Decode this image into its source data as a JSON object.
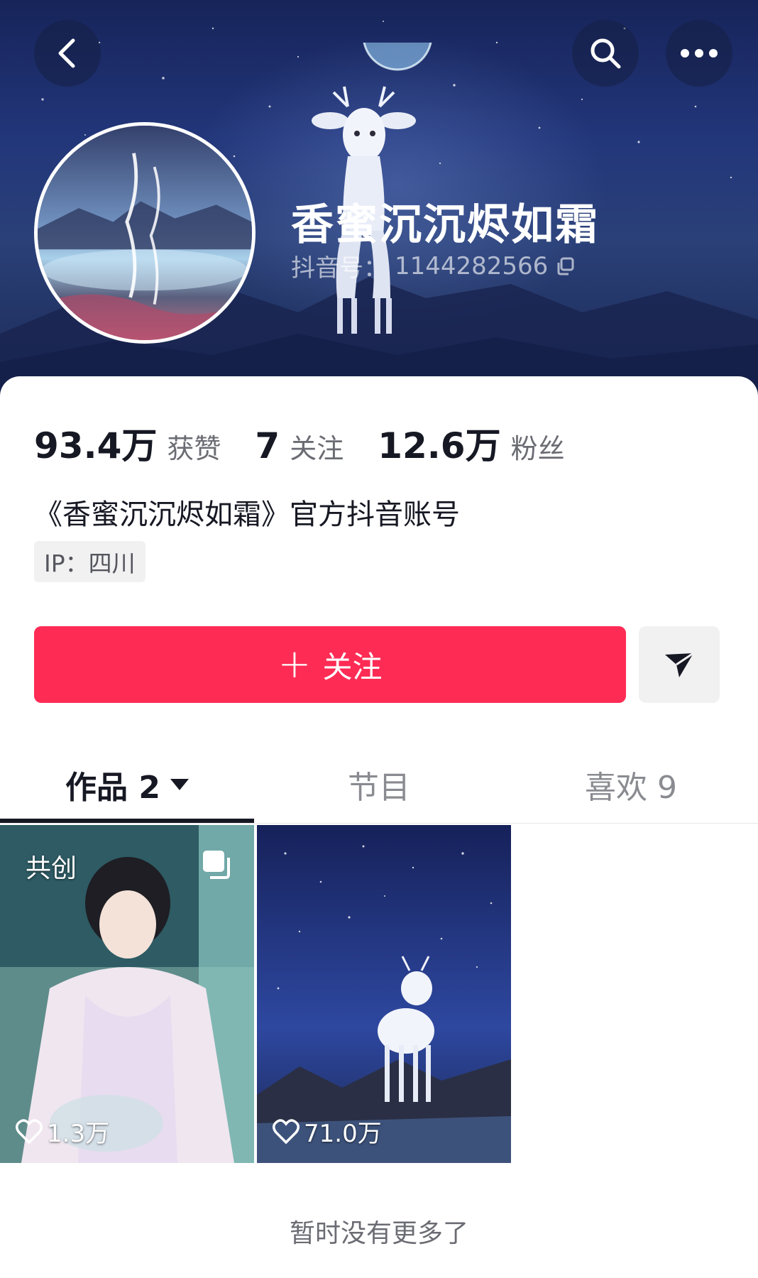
{
  "header": {
    "back_icon": "chevron-left-icon",
    "search_icon": "search-icon",
    "more_icon": "more-horizontal-icon"
  },
  "profile": {
    "name": "香蜜沉沉烬如霜",
    "douyin_id_label": "抖音号：",
    "douyin_id": "1144282566",
    "copy_icon": "copy-icon"
  },
  "stats": [
    {
      "value": "93.4万",
      "label": "获赞"
    },
    {
      "value": "7",
      "label": "关注"
    },
    {
      "value": "12.6万",
      "label": "粉丝"
    }
  ],
  "bio": "《香蜜沉沉烬如霜》官方抖音账号",
  "ip_tag": "IP：四川",
  "actions": {
    "follow_plus": "+",
    "follow_label": "关注",
    "follow_color": "#fe2c55",
    "share_icon": "send-icon"
  },
  "tabs": [
    {
      "label": "作品 2",
      "active": true
    },
    {
      "label": "节目",
      "active": false
    },
    {
      "label": "喜欢 9",
      "active": false
    }
  ],
  "videos": [
    {
      "badge": "共创",
      "likes": "1.3万",
      "multi": true
    },
    {
      "badge": "",
      "likes": "71.0万",
      "multi": false
    }
  ],
  "footer_text": "暂时没有更多了"
}
